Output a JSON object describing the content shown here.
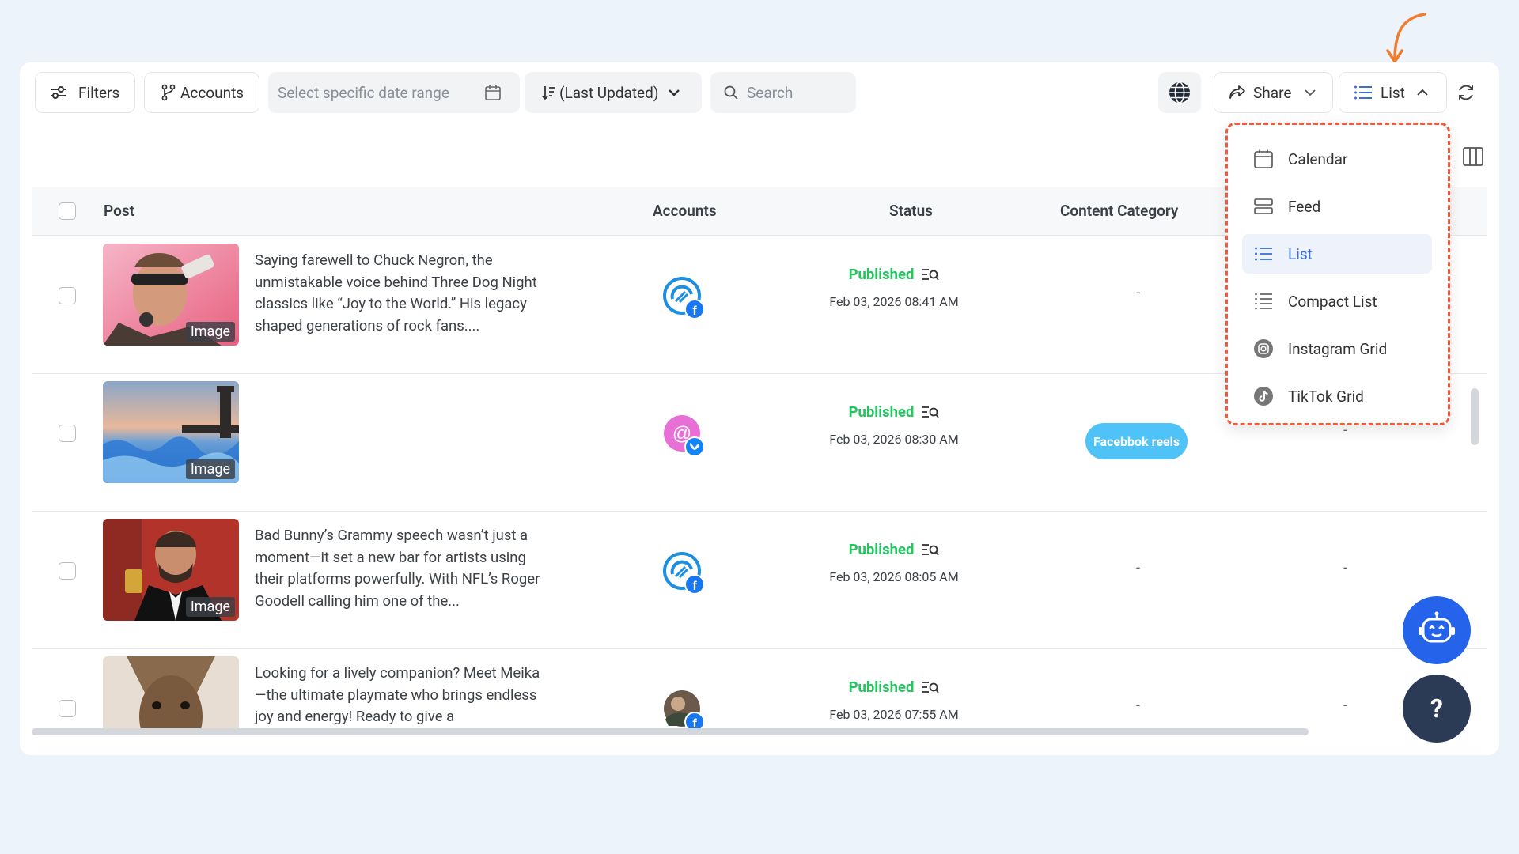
{
  "toolbar": {
    "filters_label": "Filters",
    "accounts_label": "Accounts",
    "date_placeholder": "Select specific date range",
    "sort_label": "(Last Updated)",
    "search_placeholder": "Search",
    "share_label": "Share",
    "view_label": "List"
  },
  "table": {
    "headers": [
      "Post",
      "Accounts",
      "Status",
      "Content Category"
    ],
    "rows": [
      {
        "thumb_label": "Image",
        "caption": "Saying farewell to Chuck Negron, the unmistakable voice behind Three Dog Night classics like “Joy to the World.” His legacy shaped generations of rock fans....",
        "account": "threads-facebook",
        "status": "Published",
        "date": "Feb 03, 2026 08:41 AM",
        "category": "-",
        "extra": ""
      },
      {
        "thumb_label": "Image",
        "caption": "",
        "account": "threads-bluesky",
        "status": "Published",
        "date": "Feb 03, 2026 08:30 AM",
        "category": "Facebbok reels",
        "extra": "-"
      },
      {
        "thumb_label": "Image",
        "caption": "Bad Bunny’s Grammy speech wasn’t just a moment—it set a new bar for artists using their platforms powerfully. With NFL’s Roger Goodell calling him one of the...",
        "account": "threads-facebook",
        "status": "Published",
        "date": "Feb 03, 2026 08:05 AM",
        "category": "-",
        "extra": "-"
      },
      {
        "thumb_label": "",
        "caption": "Looking for a lively companion? Meet Meika—the ultimate playmate who brings endless joy and energy! Ready to give a",
        "account": "avatar-facebook",
        "status": "Published",
        "date": "Feb 03, 2026 07:55 AM",
        "category": "-",
        "extra": "-"
      }
    ]
  },
  "view_menu": {
    "items": [
      "Calendar",
      "Feed",
      "List",
      "Compact List",
      "Instagram Grid",
      "TikTok Grid"
    ],
    "active": "List"
  },
  "fab": {
    "help_label": "?"
  },
  "colors": {
    "published": "#22c55e",
    "active_blue": "#3b6fd8",
    "highlight_dash": "#f05a3c",
    "arrow": "#f07c2c",
    "fab_bot": "#2563eb",
    "fab_help": "#2b3a55",
    "badge": "#4fc3f7"
  }
}
